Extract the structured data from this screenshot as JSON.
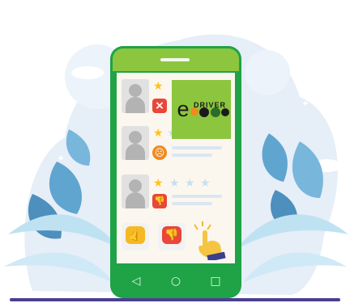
{
  "reviews": [
    {
      "rating": 1,
      "badge": "×"
    },
    {
      "rating": 1,
      "badge": "☹"
    },
    {
      "rating": 1,
      "badge": "👎"
    }
  ],
  "logo": {
    "e_letter": "e",
    "brand_rest": "DRIVER"
  },
  "actions": {
    "like": "👍",
    "dislike": "👎"
  },
  "nav": {
    "back": "◁",
    "home": "○",
    "recent": "□"
  },
  "colors": {
    "phone_body": "#1fa346",
    "phone_top": "#8cc63f",
    "star_filled": "#ffc21b",
    "badge_red": "#e8473a",
    "badge_orange": "#f08a1f",
    "background_shapes": "#e8f0f8"
  }
}
